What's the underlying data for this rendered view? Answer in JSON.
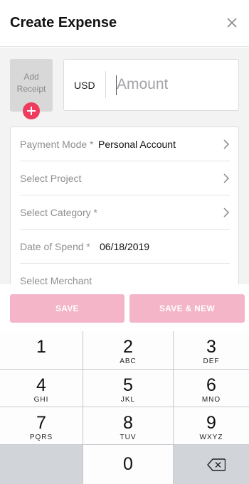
{
  "header": {
    "title": "Create Expense",
    "close_icon": "close-icon"
  },
  "receipt": {
    "label_line1": "Add",
    "label_line2": "Receipt",
    "add_icon": "plus-icon",
    "add_color": "#ee3b5e"
  },
  "amount": {
    "currency": "USD",
    "placeholder": "Amount",
    "value": ""
  },
  "form": {
    "rows": [
      {
        "label": "Payment Mode *",
        "value": "Personal Account",
        "chevron": true
      },
      {
        "label": "Select Project",
        "value": "",
        "chevron": true
      },
      {
        "label": "Select Category *",
        "value": "",
        "chevron": true
      },
      {
        "label": "Date of Spend *",
        "value": "06/18/2019",
        "chevron": false
      },
      {
        "label": "Select Merchant",
        "value": "",
        "chevron": false
      }
    ]
  },
  "actions": {
    "save_label": "SAVE",
    "save_new_label": "SAVE & NEW",
    "button_color": "#f3b5c7"
  },
  "keypad": {
    "keys": [
      {
        "num": "1",
        "letters": ""
      },
      {
        "num": "2",
        "letters": "ABC"
      },
      {
        "num": "3",
        "letters": "DEF"
      },
      {
        "num": "4",
        "letters": "GHI"
      },
      {
        "num": "5",
        "letters": "JKL"
      },
      {
        "num": "6",
        "letters": "MNO"
      },
      {
        "num": "7",
        "letters": "PQRS"
      },
      {
        "num": "8",
        "letters": "TUV"
      },
      {
        "num": "9",
        "letters": "WXYZ"
      },
      {
        "num": "0",
        "letters": ""
      }
    ],
    "delete_icon": "backspace-icon"
  }
}
